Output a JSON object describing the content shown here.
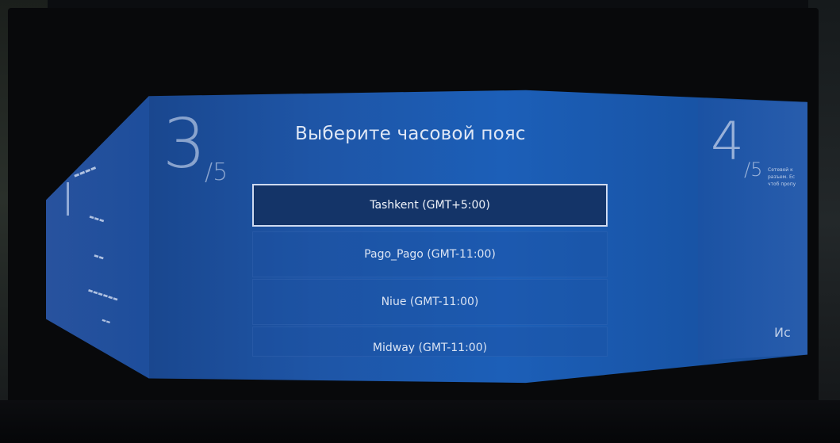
{
  "step": {
    "current_number": "3",
    "current_total": "/5",
    "next_number": "4",
    "next_total": "/5"
  },
  "title": "Выберите часовой пояс",
  "timezones": [
    {
      "label": "Tashkent  (GMT+5:00)",
      "selected": true
    },
    {
      "label": "Pago_Pago  (GMT-11:00)",
      "selected": false
    },
    {
      "label": "Niue  (GMT-11:00)",
      "selected": false
    },
    {
      "label": "Midway  (GMT-11:00)",
      "selected": false
    }
  ],
  "next_panel": {
    "description": "Сетевой к разъем. Ес чтоб пропу",
    "button_fragment": "Ис"
  },
  "colors": {
    "panel_blue": "#1c5fb8",
    "selected_bg": "#143468",
    "text": "#dbe4f3"
  }
}
